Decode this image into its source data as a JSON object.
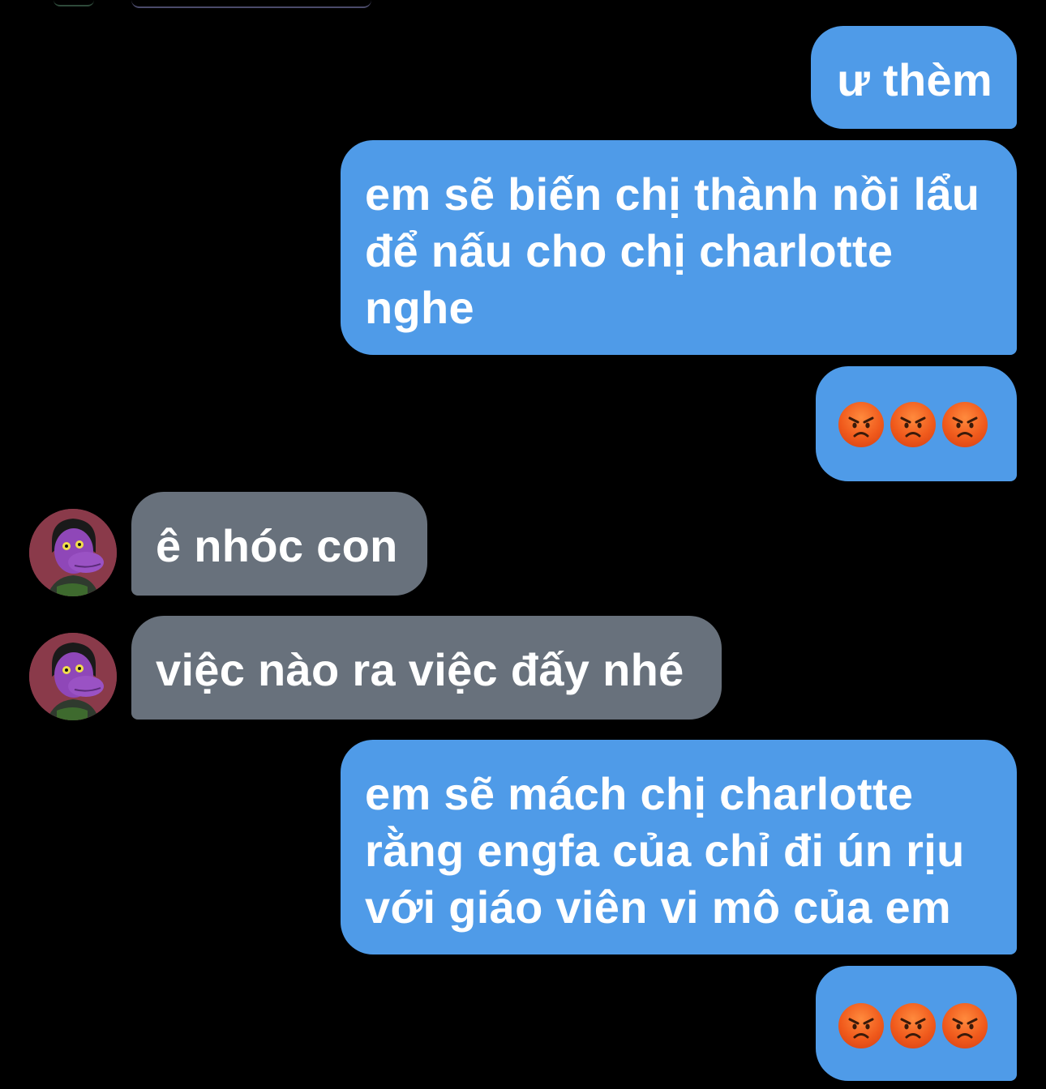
{
  "messages": [
    {
      "side": "out",
      "text_lines": [
        "ư thèm"
      ]
    },
    {
      "side": "out",
      "text_lines": [
        "em sẽ biến chị thành nồi lẩu",
        "để nấu cho chị charlotte",
        "nghe"
      ]
    },
    {
      "side": "out",
      "emoji": [
        "angry-face",
        "angry-face",
        "angry-face"
      ]
    },
    {
      "side": "in",
      "text_lines": [
        "ê nhóc con"
      ]
    },
    {
      "side": "in",
      "text_lines": [
        "việc nào ra việc đấy nhé"
      ]
    },
    {
      "side": "out",
      "text_lines": [
        "em sẽ mách chị charlotte",
        "rằng engfa của chỉ đi ún rịu",
        "với giáo viên vi mô của em"
      ]
    },
    {
      "side": "out",
      "emoji": [
        "angry-face",
        "angry-face",
        "angry-face"
      ]
    }
  ],
  "colors": {
    "background": "#000000",
    "outgoing_bubble": "#4f9be8",
    "incoming_bubble": "#68717c",
    "text": "#ffffff"
  },
  "icons": {
    "emoji": "angry-face",
    "avatar": "purple-character-avatar"
  }
}
